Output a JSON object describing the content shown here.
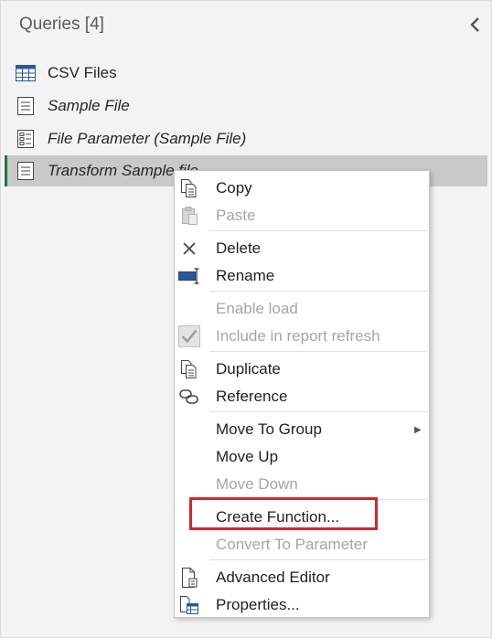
{
  "panel": {
    "title": "Queries [4]",
    "collapse_icon": "chevron-left-icon"
  },
  "queries": [
    {
      "label": "CSV Files",
      "icon": "table-icon",
      "italic": false,
      "selected": false
    },
    {
      "label": "Sample File",
      "icon": "document-icon",
      "italic": true,
      "selected": false
    },
    {
      "label": "File Parameter (Sample File)",
      "icon": "parameter-icon",
      "italic": true,
      "selected": false
    },
    {
      "label": "Transform Sample file",
      "icon": "document-icon",
      "italic": true,
      "selected": true
    }
  ],
  "context_menu": {
    "items": [
      {
        "label": "Copy",
        "icon": "copy-icon",
        "enabled": true
      },
      {
        "label": "Paste",
        "icon": "paste-icon",
        "enabled": false
      },
      {
        "label": "Delete",
        "icon": "delete-icon",
        "enabled": true
      },
      {
        "label": "Rename",
        "icon": "rename-icon",
        "enabled": true
      },
      {
        "label": "Enable load",
        "icon": "",
        "enabled": false
      },
      {
        "label": "Include in report refresh",
        "icon": "checkbox-checked-icon",
        "enabled": false
      },
      {
        "label": "Duplicate",
        "icon": "duplicate-icon",
        "enabled": true
      },
      {
        "label": "Reference",
        "icon": "reference-icon",
        "enabled": true
      },
      {
        "label": "Move To Group",
        "icon": "",
        "enabled": true,
        "submenu": true
      },
      {
        "label": "Move Up",
        "icon": "",
        "enabled": true
      },
      {
        "label": "Move Down",
        "icon": "",
        "enabled": false
      },
      {
        "label": "Create Function...",
        "icon": "",
        "enabled": true,
        "highlighted": true
      },
      {
        "label": "Convert To Parameter",
        "icon": "",
        "enabled": false
      },
      {
        "label": "Advanced Editor",
        "icon": "advanced-editor-icon",
        "enabled": true
      },
      {
        "label": "Properties...",
        "icon": "properties-icon",
        "enabled": true
      }
    ]
  },
  "colors": {
    "selected_accent": "#217346",
    "highlight_box": "#d9232d",
    "disabled_text": "#a6a6a6"
  }
}
